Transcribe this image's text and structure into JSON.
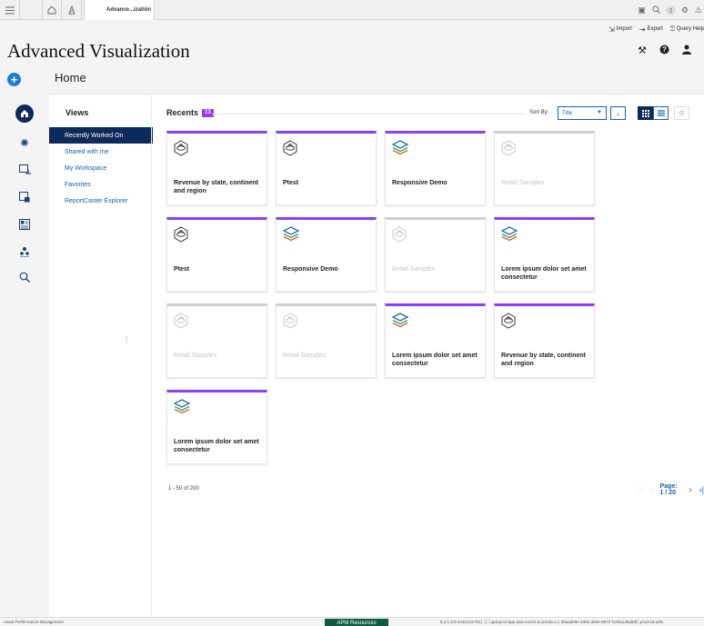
{
  "tabstrip": {
    "active_tab": "Advance...ization",
    "close": "×"
  },
  "toolbar": {
    "import": "Import",
    "export": "Export",
    "query_help": "Query Help"
  },
  "app": {
    "title": "Advanced Visualization"
  },
  "breadcrumb": {
    "home": "Home"
  },
  "views": {
    "title": "Views",
    "items": [
      {
        "label": "Recently Worked On",
        "active": true
      },
      {
        "label": "Shared with me"
      },
      {
        "label": "My Workspace"
      },
      {
        "label": "Favorites"
      },
      {
        "label": "ReportCaster Explorer"
      }
    ]
  },
  "recents": {
    "title": "Recents",
    "count": "13",
    "sort_label": "Sort By:",
    "sort_value": "Title",
    "cards": [
      {
        "title": "Revenue by state, continent and region",
        "icon": "chart-sphere-icon",
        "disabled": false
      },
      {
        "title": "Ptest",
        "icon": "chart-sphere-icon",
        "disabled": false
      },
      {
        "title": "Responsive Demo",
        "icon": "layers-icon",
        "disabled": false
      },
      {
        "title": "Retail Samples",
        "icon": "chart-sphere-icon",
        "disabled": true
      },
      {
        "title": "Ptest",
        "icon": "chart-sphere-icon",
        "disabled": false
      },
      {
        "title": "Responsive Demo",
        "icon": "layers-icon",
        "disabled": false
      },
      {
        "title": "Retail Samples",
        "icon": "chart-sphere-icon",
        "disabled": true
      },
      {
        "title": "Lorem ipsum dolor set amet consectetur",
        "icon": "layers-icon",
        "disabled": false
      },
      {
        "title": "Retail Samples",
        "icon": "chart-sphere-icon",
        "disabled": true
      },
      {
        "title": "Retail Samples",
        "icon": "chart-sphere-icon",
        "disabled": true
      },
      {
        "title": "Lorem ipsum dolor set amet consectetur",
        "icon": "layers-icon",
        "disabled": false
      },
      {
        "title": "Revenue by state, continent and region",
        "icon": "chart-sphere-icon",
        "disabled": false
      },
      {
        "title": "Lorem ipsum dolor set amet consectetur",
        "icon": "layers-icon",
        "disabled": false
      }
    ],
    "range": "1 - 50 of 200",
    "page": "Page: 1 / 20"
  },
  "statusbar": {
    "left": "Asset Performance Management",
    "center": "APM Resources",
    "right": "5.2.1.0.0-2431215700  |  ⓘ  |  apmprod.app.aws-euc01-pr.predix.io  |  2baa859e-4394-480e-9970-f120a1d6dddf  |  prod-s3-adm"
  },
  "colors": {
    "accent_purple": "#8a3ffc",
    "navy": "#0d2a5c",
    "link_blue": "#1a5fb4",
    "add_blue": "#1a7fd6",
    "status_green": "#0f5b3f"
  }
}
